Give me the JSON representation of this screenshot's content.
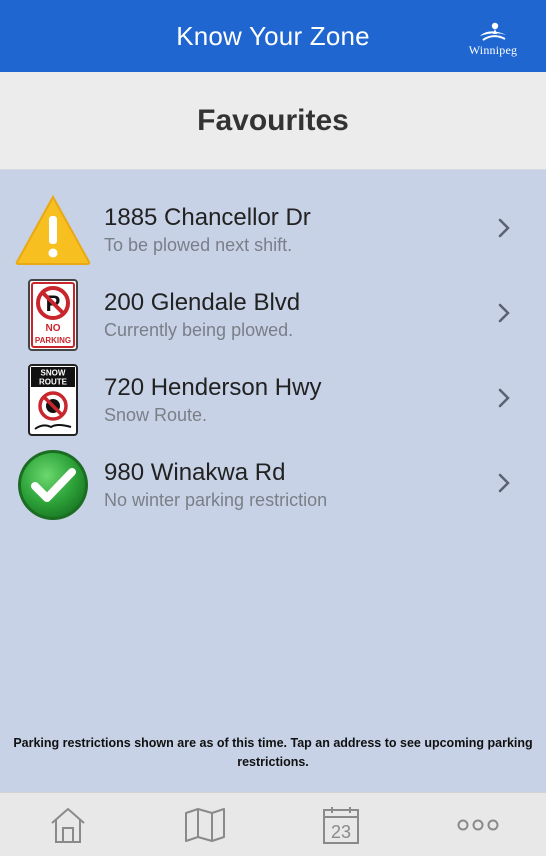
{
  "header": {
    "title": "Know Your Zone",
    "logo_text": "Winnipeg"
  },
  "section": {
    "title": "Favourites"
  },
  "favourites": [
    {
      "address": "1885 Chancellor Dr",
      "status": "To be plowed next shift.",
      "icon": "warning-icon"
    },
    {
      "address": "200 Glendale Blvd",
      "status": "Currently being plowed.",
      "icon": "no-parking-sign-icon"
    },
    {
      "address": "720 Henderson Hwy",
      "status": "Snow Route.",
      "icon": "snow-route-sign-icon"
    },
    {
      "address": "980 Winakwa Rd",
      "status": "No winter parking restriction",
      "icon": "checkmark-icon"
    }
  ],
  "signs": {
    "no_parking_line1": "NO",
    "no_parking_line2": "PARKING",
    "snow_route_line1": "SNOW",
    "snow_route_line2": "ROUTE"
  },
  "footer_note": "Parking restrictions shown are as of this time. Tap an address to see upcoming parking restrictions.",
  "nav": {
    "calendar_day": "23",
    "items": [
      "home-icon",
      "map-icon",
      "calendar-icon",
      "more-icon"
    ]
  },
  "colors": {
    "header_blue": "#1f66d1",
    "list_background": "#c7d2e6",
    "warning_yellow": "#f7bf1f",
    "check_green": "#2ea43a"
  }
}
